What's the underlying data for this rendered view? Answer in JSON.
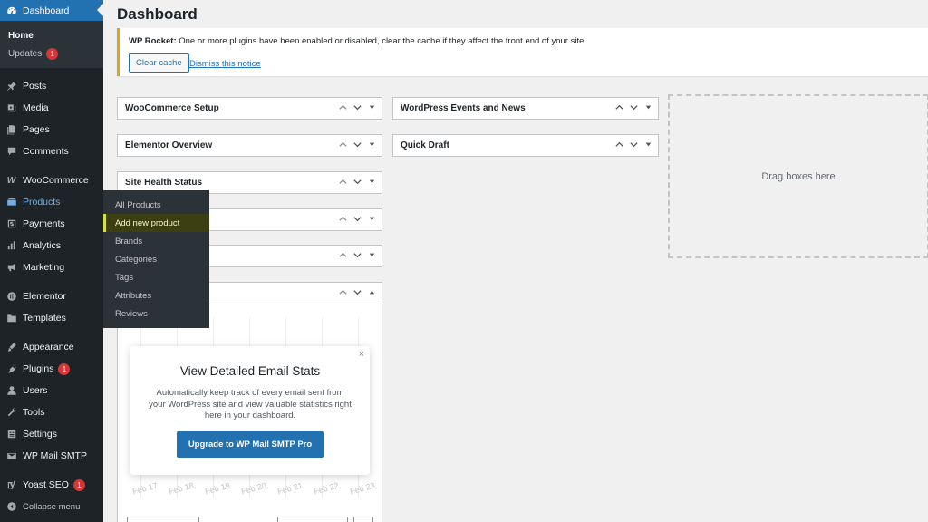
{
  "sidebar": {
    "dashboard_label": "Dashboard",
    "submenu": [
      {
        "label": "Home",
        "badge": ""
      },
      {
        "label": "Updates",
        "badge": "1"
      }
    ],
    "items": [
      {
        "label": "Posts",
        "icon": "pin-icon",
        "badge": ""
      },
      {
        "label": "Media",
        "icon": "media-icon",
        "badge": ""
      },
      {
        "label": "Pages",
        "icon": "pages-icon",
        "badge": ""
      },
      {
        "label": "Comments",
        "icon": "comments-icon",
        "badge": ""
      },
      {
        "label": "WooCommerce",
        "icon": "woocommerce-icon",
        "badge": ""
      },
      {
        "label": "Products",
        "icon": "products-icon",
        "badge": ""
      },
      {
        "label": "Payments",
        "icon": "payments-icon",
        "badge": ""
      },
      {
        "label": "Analytics",
        "icon": "analytics-icon",
        "badge": ""
      },
      {
        "label": "Marketing",
        "icon": "megaphone-icon",
        "badge": ""
      },
      {
        "label": "Elementor",
        "icon": "elementor-icon",
        "badge": ""
      },
      {
        "label": "Templates",
        "icon": "folder-icon",
        "badge": ""
      },
      {
        "label": "Appearance",
        "icon": "brush-icon",
        "badge": ""
      },
      {
        "label": "Plugins",
        "icon": "plugin-icon",
        "badge": "1"
      },
      {
        "label": "Users",
        "icon": "user-icon",
        "badge": ""
      },
      {
        "label": "Tools",
        "icon": "wrench-icon",
        "badge": ""
      },
      {
        "label": "Settings",
        "icon": "settings-icon",
        "badge": ""
      },
      {
        "label": "WP Mail SMTP",
        "icon": "mail-icon",
        "badge": ""
      },
      {
        "label": "Yoast SEO",
        "icon": "yoast-icon",
        "badge": "1"
      },
      {
        "label": "Collapse menu",
        "icon": "collapse-icon",
        "badge": ""
      }
    ]
  },
  "flyout": {
    "items": [
      "All Products",
      "Add new product",
      "Brands",
      "Categories",
      "Tags",
      "Attributes",
      "Reviews"
    ],
    "highlighted": "Add new product"
  },
  "page": {
    "title": "Dashboard"
  },
  "notice": {
    "prefix": "WP Rocket:",
    "message": " One or more plugins have been enabled or disabled, clear the cache if they affect the front end of your site.",
    "clear_cache_label": "Clear cache",
    "dismiss_label": "Dismiss this notice"
  },
  "widgets": {
    "col1": [
      "WooCommerce Setup",
      "Elementor Overview",
      "Site Health Status",
      "",
      "",
      ""
    ],
    "col2": [
      "WordPress Events and News",
      "Quick Draft"
    ],
    "drop_zone": "Drag boxes here"
  },
  "chart": {
    "x_ticks": [
      "Feb 17",
      "Feb 18",
      "Feb 19",
      "Feb 20",
      "Feb 21",
      "Feb 22",
      "Feb 23"
    ]
  },
  "modal": {
    "title": "View Detailed Email Stats",
    "description": "Automatically keep track of every email sent from your WordPress site and view valuable statistics right here in your dashboard.",
    "button_label": "Upgrade to WP Mail SMTP Pro",
    "close": "×"
  },
  "colors": {
    "admin_bar_bg": "#1d2327",
    "accent_blue": "#2271b1",
    "notice_border": "#dba617",
    "badge_red": "#d63638"
  }
}
